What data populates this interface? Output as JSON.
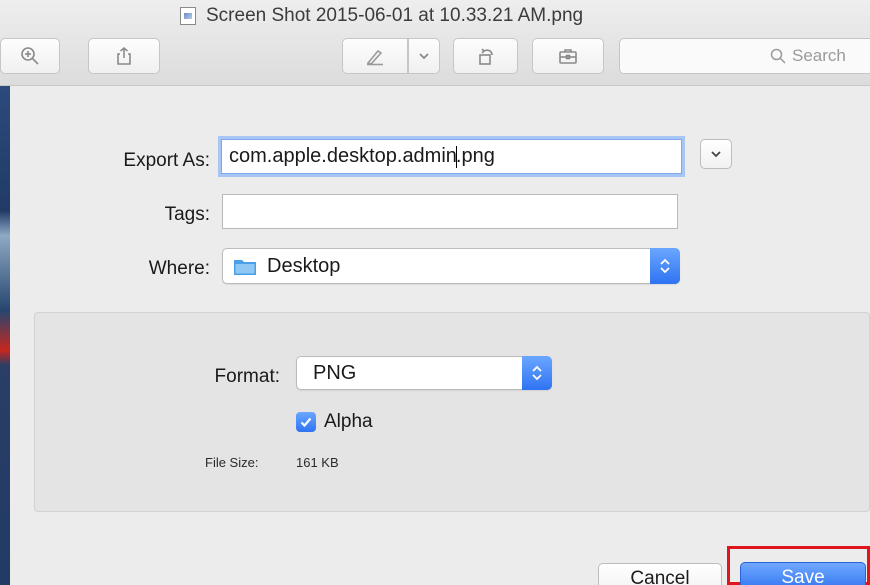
{
  "window": {
    "title": "Screen Shot 2015-06-01 at 10.33.21 AM.png"
  },
  "toolbar": {
    "buttons": [
      {
        "name": "zoom-in-button",
        "icon": "zoom-in-icon"
      },
      {
        "name": "share-button",
        "icon": "share-icon"
      },
      {
        "name": "markup-button",
        "icon": "pen-icon"
      },
      {
        "name": "markup-menu-button",
        "icon": "chevron-down-icon"
      },
      {
        "name": "rotate-button",
        "icon": "rotate-icon"
      },
      {
        "name": "toolbox-button",
        "icon": "toolbox-icon"
      }
    ],
    "search_placeholder": "Search"
  },
  "export_sheet": {
    "export_as_label": "Export As:",
    "filename_before_caret": "com.apple.desktop.admin",
    "filename_after_caret": ".png",
    "tags_label": "Tags:",
    "tags_value": "",
    "where_label": "Where:",
    "where_value": "Desktop",
    "format_label": "Format:",
    "format_value": "PNG",
    "alpha_label": "Alpha",
    "alpha_checked": true,
    "file_size_label": "File Size:",
    "file_size_value": "161 KB",
    "cancel_label": "Cancel",
    "save_label": "Save"
  },
  "colors": {
    "accent": "#2f73f2",
    "highlight": "#e0161f",
    "folder": "#4aa0e6"
  }
}
